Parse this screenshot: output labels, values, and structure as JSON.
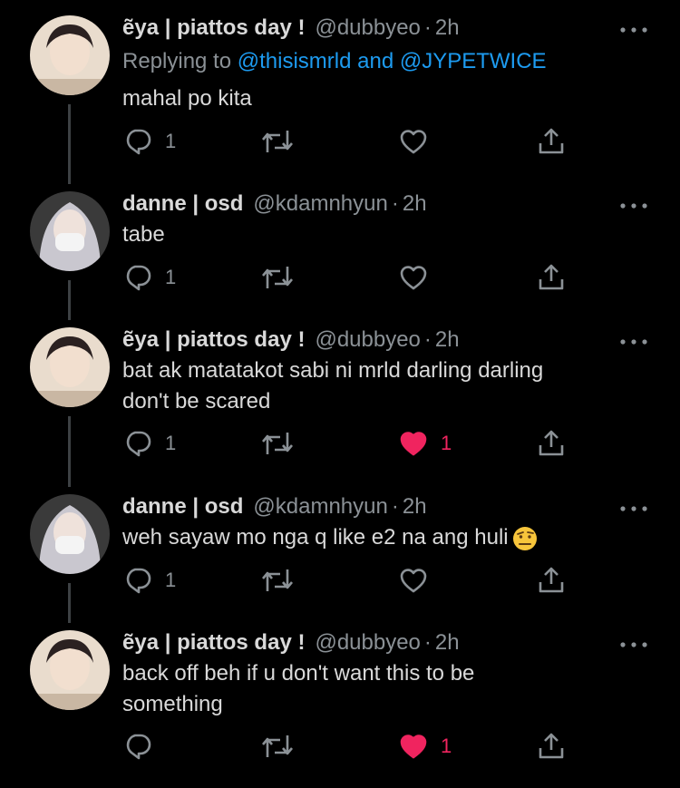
{
  "tweets": [
    {
      "name": "ẽya | piattos day !",
      "handle": "@dubbyeo",
      "sep": "·",
      "time": "2h",
      "reply_prefix": "Replying to",
      "reply_mentions": "@thisismrld and @JYPETWICE",
      "lines": [
        "mahal po kita"
      ],
      "reply_count": "1",
      "like_count": "",
      "liked": false
    },
    {
      "name": "danne | osd",
      "handle": "@kdamnhyun",
      "sep": "·",
      "time": "2h",
      "lines": [
        "tabe"
      ],
      "reply_count": "1",
      "like_count": "",
      "liked": false
    },
    {
      "name": "ẽya | piattos day !",
      "handle": "@dubbyeo",
      "sep": "·",
      "time": "2h",
      "lines": [
        "bat ak matatakot sabi ni mrld darling darling",
        "don't be scared"
      ],
      "reply_count": "1",
      "like_count": "1",
      "liked": true
    },
    {
      "name": "danne | osd",
      "handle": "@kdamnhyun",
      "sep": "·",
      "time": "2h",
      "lines": [
        "weh sayaw mo nga q like e2 na ang huli"
      ],
      "emoji": "face-with-raised-eyebrow",
      "reply_count": "1",
      "like_count": "",
      "liked": false
    },
    {
      "name": "ẽya | piattos day !",
      "handle": "@dubbyeo",
      "sep": "·",
      "time": "2h",
      "lines": [
        "back off beh if u don't want this to be",
        "something"
      ],
      "reply_count": "",
      "like_count": "1",
      "liked": true
    }
  ],
  "icons": {
    "reply": "reply-icon",
    "retweet": "retweet-icon",
    "like": "heart-icon",
    "share": "share-icon",
    "more": "more-icon"
  },
  "colors": {
    "background": "#000000",
    "text": "#d9d9d9",
    "muted": "#8b9196",
    "link": "#1d9bf0",
    "like_active": "#f0245f",
    "thread_line": "#3d4144"
  }
}
